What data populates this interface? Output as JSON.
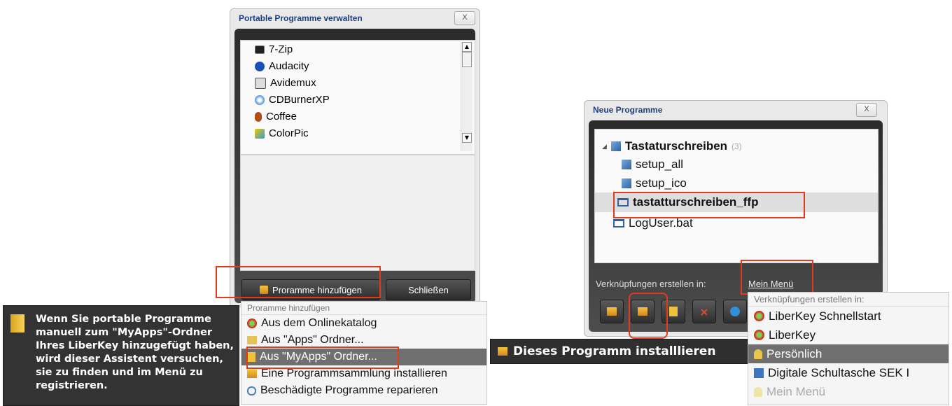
{
  "manage_window": {
    "title": "Portable Programme verwalten",
    "close_label": "X",
    "programs": [
      {
        "name": "7-Zip",
        "icon": "7zip-icon"
      },
      {
        "name": "Audacity",
        "icon": "audacity-icon"
      },
      {
        "name": "Avidemux",
        "icon": "avidemux-icon"
      },
      {
        "name": "CDBurnerXP",
        "icon": "cdburner-icon"
      },
      {
        "name": "Coffee",
        "icon": "coffee-icon"
      },
      {
        "name": "ColorPic",
        "icon": "colorpic-icon"
      }
    ],
    "add_button": "Proramme hinzufügen",
    "close_button": "Schließen"
  },
  "add_menu": {
    "header": "Proramme hinzufügen",
    "items": [
      {
        "label": "Aus dem Onlinekatalog"
      },
      {
        "label": "Aus \"Apps\" Ordner..."
      },
      {
        "label": "Aus \"MyApps\" Ordner..."
      },
      {
        "label": "Eine Programmsammlung installieren"
      },
      {
        "label": "Beschädigte Programme reparieren"
      }
    ]
  },
  "tooltip": {
    "text": "Wenn Sie portable Programme manuell zum \"MyApps\"-Ordner Ihres LiberKey hinzugefügt haben, wird dieser Assistent versuchen, sie zu finden und im Menü zu registrieren."
  },
  "new_window": {
    "title": "Neue Programme",
    "close_label": "X",
    "tree": {
      "group": "Tastaturschreiben",
      "group_count": "(3)",
      "children": [
        "setup_all",
        "setup_ico",
        "tastatturschreiben_ffp"
      ],
      "other": "LogUser.bat"
    },
    "shortcut_label": "Verknüpfungen erstellen in:",
    "shortcut_value": "Mein Menü"
  },
  "install_tooltip": {
    "label": "Dieses Programm installlieren"
  },
  "shortcut_menu": {
    "header": "Verknüpfungen erstellen in:",
    "items": [
      {
        "label": "LiberKey Schnellstart"
      },
      {
        "label": "LiberKey"
      },
      {
        "label": "Persönlich"
      },
      {
        "label": "Digitale Schultasche SEK I"
      },
      {
        "label": "Mein Menü"
      }
    ]
  },
  "colors": {
    "highlight_red": "#e23b1c",
    "title_blue": "#1f3f7f",
    "menu_selected": "#6f6f6f"
  }
}
